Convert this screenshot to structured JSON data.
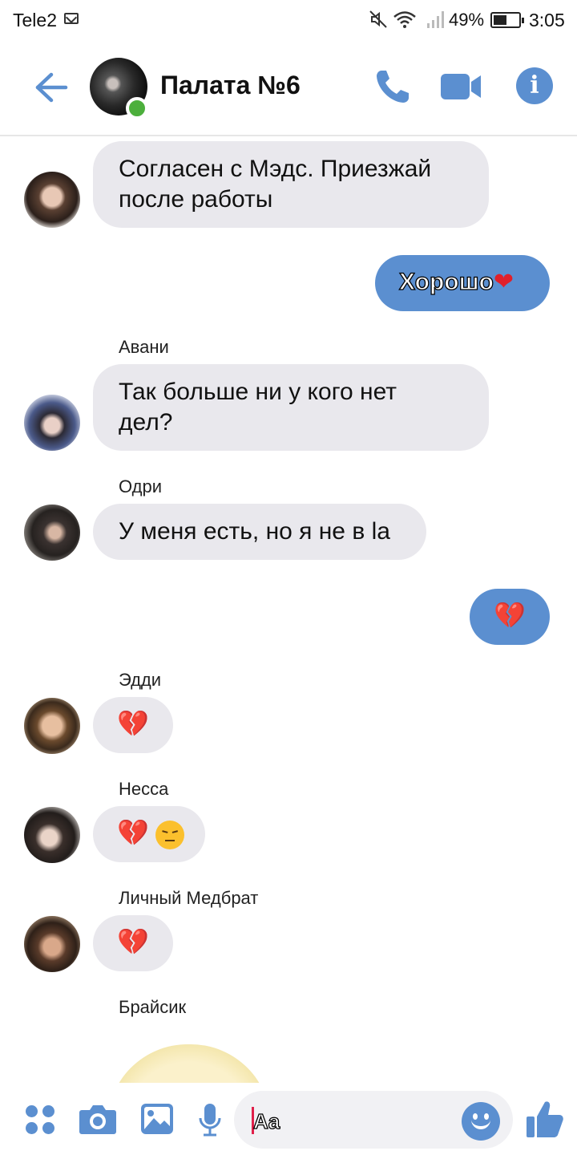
{
  "status_bar": {
    "carrier": "Tele2",
    "battery": "49%",
    "time": "3:05",
    "icons": [
      "mail-icon",
      "mute-icon",
      "wifi-icon",
      "signal-icon",
      "battery-icon"
    ]
  },
  "header": {
    "title": "Палата №6",
    "online": true,
    "icons": [
      "back-arrow-icon",
      "phone-icon",
      "video-camera-icon",
      "info-icon"
    ]
  },
  "messages": [
    {
      "direction": "in",
      "sender": "",
      "text": "Согласен с Мэдс. Приезжай после работы",
      "line1": "Согласен с Мэдс. Приезжай",
      "line2": "после работы"
    },
    {
      "direction": "out",
      "text": "Хорошо",
      "emoji": "heart"
    },
    {
      "direction": "in",
      "sender": "Авани",
      "line1": "Так больше ни у кого нет",
      "line2": "дел?"
    },
    {
      "direction": "in",
      "sender": "Одри",
      "text": "У меня есть, но я не в la"
    },
    {
      "direction": "out",
      "emoji": "broken-heart"
    },
    {
      "direction": "in",
      "sender": "Эдди",
      "emoji": "broken-heart"
    },
    {
      "direction": "in",
      "sender": "Несса",
      "emoji": "broken-heart pensive-face"
    },
    {
      "direction": "in",
      "sender": "Личный Медбрат",
      "emoji": "broken-heart"
    },
    {
      "direction": "in",
      "sender": "Брайсик",
      "emoji": "sticker"
    }
  ],
  "composer": {
    "input_value": "Aa",
    "icons": [
      "apps-menu-icon",
      "camera-icon",
      "gallery-icon",
      "microphone-icon",
      "emoji-icon",
      "thumbs-up-icon"
    ]
  },
  "colors": {
    "accent": "#5b8fd0",
    "incoming_bubble": "#e9e8ed",
    "online": "#4caf3c",
    "heart": "#e0202a"
  }
}
